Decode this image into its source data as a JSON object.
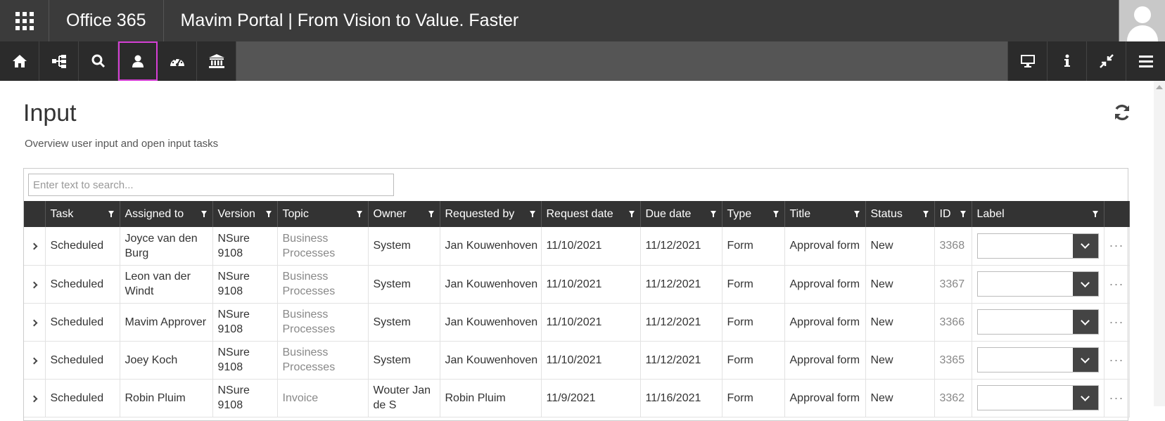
{
  "suite": {
    "title": "Office 365",
    "portal_title": "Mavim Portal | From Vision to Value. Faster"
  },
  "toolbar": {
    "left": [
      {
        "icon": "home-icon"
      },
      {
        "icon": "tree-icon"
      },
      {
        "icon": "search-icon"
      },
      {
        "icon": "user-icon",
        "active": true
      },
      {
        "icon": "dashboard-icon"
      },
      {
        "icon": "bank-icon"
      }
    ],
    "right": [
      {
        "icon": "monitor-icon"
      },
      {
        "icon": "info-icon"
      },
      {
        "icon": "collapse-icon"
      },
      {
        "icon": "hamburger-icon"
      }
    ]
  },
  "page": {
    "title": "Input",
    "subtitle": "Overview user input and open input tasks",
    "search_placeholder": "Enter text to search..."
  },
  "table": {
    "columns": [
      "Task",
      "Assigned to",
      "Version",
      "Topic",
      "Owner",
      "Requested by",
      "Request date",
      "Due date",
      "Type",
      "Title",
      "Status",
      "ID",
      "Label"
    ],
    "rows": [
      {
        "task": "Scheduled",
        "assigned_to": "Joyce van den Burg",
        "version": "NSure 9108",
        "topic": "Business Processes",
        "owner": "System",
        "requested_by": "Jan Kouwenhoven",
        "request_date": "11/10/2021",
        "due_date": "11/12/2021",
        "type": "Form",
        "title": "Approval form",
        "status": "New",
        "id": "3368",
        "label": ""
      },
      {
        "task": "Scheduled",
        "assigned_to": "Leon van der Windt",
        "version": "NSure 9108",
        "topic": "Business Processes",
        "owner": "System",
        "requested_by": "Jan Kouwenhoven",
        "request_date": "11/10/2021",
        "due_date": "11/12/2021",
        "type": "Form",
        "title": "Approval form",
        "status": "New",
        "id": "3367",
        "label": ""
      },
      {
        "task": "Scheduled",
        "assigned_to": "Mavim Approver",
        "version": "NSure 9108",
        "topic": "Business Processes",
        "owner": "System",
        "requested_by": "Jan Kouwenhoven",
        "request_date": "11/10/2021",
        "due_date": "11/12/2021",
        "type": "Form",
        "title": "Approval form",
        "status": "New",
        "id": "3366",
        "label": ""
      },
      {
        "task": "Scheduled",
        "assigned_to": "Joey Koch",
        "version": "NSure 9108",
        "topic": "Business Processes",
        "owner": "System",
        "requested_by": "Jan Kouwenhoven",
        "request_date": "11/10/2021",
        "due_date": "11/12/2021",
        "type": "Form",
        "title": "Approval form",
        "status": "New",
        "id": "3365",
        "label": ""
      },
      {
        "task": "Scheduled",
        "assigned_to": "Robin Pluim",
        "version": "NSure 9108",
        "topic": "Invoice",
        "owner": "Wouter Jan de S",
        "requested_by": "Robin Pluim",
        "request_date": "11/9/2021",
        "due_date": "11/16/2021",
        "type": "Form",
        "title": "Approval form",
        "status": "New",
        "id": "3362",
        "label": ""
      }
    ],
    "more_label": "···"
  }
}
